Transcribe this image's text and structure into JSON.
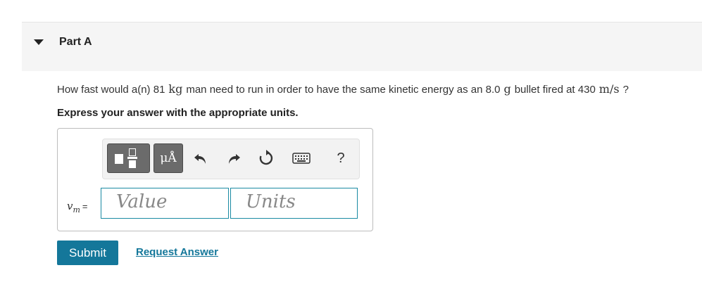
{
  "part": {
    "title": "Part A",
    "caret_icon": "caret-down-icon"
  },
  "question": {
    "prefix": "How fast would a(n) 81",
    "unit1": "kg",
    "middle": "man need to run in order to have the same kinetic energy as an 8.0",
    "unit2": "g",
    "middle2": "bullet fired at 430",
    "unit3": "m/s",
    "suffix": "?"
  },
  "instruction": "Express your answer with the appropriate units.",
  "toolbar": {
    "buttons": [
      {
        "name": "fraction-template-icon"
      },
      {
        "name": "units-icon",
        "label": "μÅ"
      },
      {
        "name": "undo-icon"
      },
      {
        "name": "redo-icon"
      },
      {
        "name": "reset-icon"
      },
      {
        "name": "keyboard-icon"
      },
      {
        "name": "help-icon",
        "label": "?"
      }
    ]
  },
  "answer": {
    "variable": "v",
    "subscript": "m",
    "equals": "=",
    "value_placeholder": "Value",
    "units_placeholder": "Units"
  },
  "actions": {
    "submit_label": "Submit",
    "request_label": "Request Answer"
  },
  "colors": {
    "accent": "#14779a",
    "field_border": "#1a8aa3",
    "toolbar_button": "#6b6b6b",
    "header_bg": "#f5f5f5"
  }
}
